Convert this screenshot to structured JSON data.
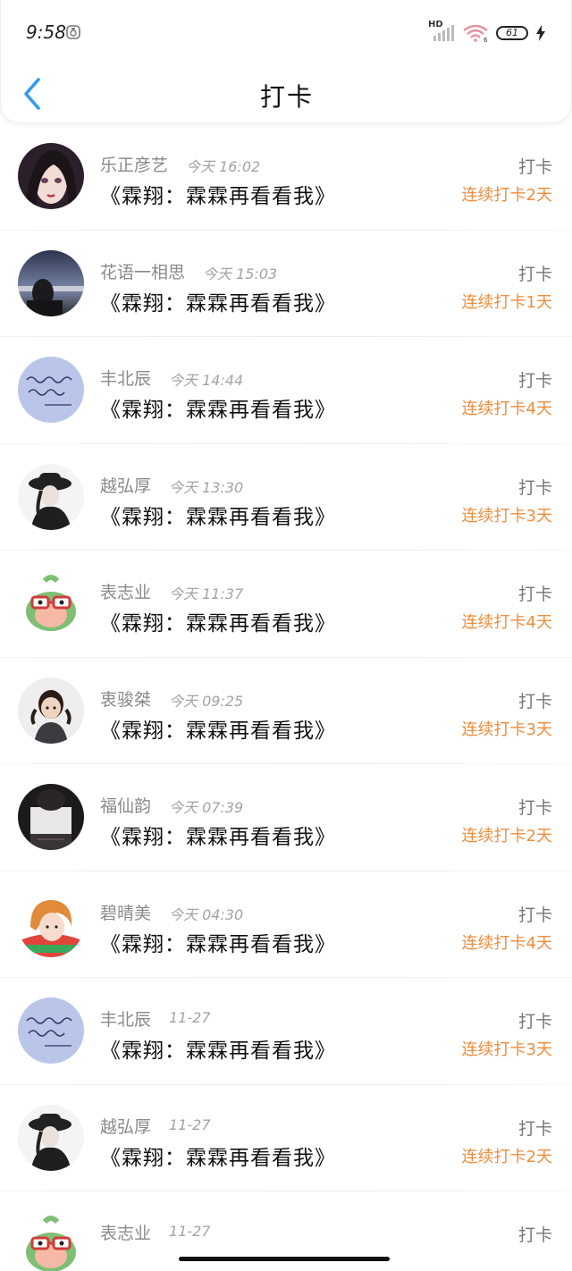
{
  "status_bar": {
    "time": "9:58",
    "hd": "HD",
    "battery": "61",
    "network_sub": "6"
  },
  "header": {
    "title": "打卡"
  },
  "colors": {
    "accent_blue": "#2f9bf0",
    "streak_orange": "#f08c3c"
  },
  "entries": [
    {
      "name": "乐正彦艺",
      "time": "今天 16:02",
      "book": "《霖翔：霖霖再看看我》",
      "action": "打卡",
      "streak": "连续打卡2天",
      "avatar": "girl-portrait-avatar"
    },
    {
      "name": "花语一相思",
      "time": "今天 15:03",
      "book": "《霖翔：霖霖再看看我》",
      "action": "打卡",
      "streak": "连续打卡1天",
      "avatar": "night-sky-girl-avatar"
    },
    {
      "name": "丰北辰",
      "time": "今天 14:44",
      "book": "《霖翔：霖霖再看看我》",
      "action": "打卡",
      "streak": "连续打卡4天",
      "avatar": "handwriting-avatar"
    },
    {
      "name": "越弘厚",
      "time": "今天 13:30",
      "book": "《霖翔：霖霖再看看我》",
      "action": "打卡",
      "streak": "连续打卡3天",
      "avatar": "hat-girl-avatar"
    },
    {
      "name": "表志业",
      "time": "今天 11:37",
      "book": "《霖翔：霖霖再看看我》",
      "action": "打卡",
      "streak": "连续打卡4天",
      "avatar": "cartoon-avatar"
    },
    {
      "name": "衷骏桀",
      "time": "今天 09:25",
      "book": "《霖翔：霖霖再看看我》",
      "action": "打卡",
      "streak": "连续打卡3天",
      "avatar": "child-avatar"
    },
    {
      "name": "福仙韵",
      "time": "今天 07:39",
      "book": "《霖翔：霖霖再看看我》",
      "action": "打卡",
      "streak": "连续打卡2天",
      "avatar": "dark-photo-avatar"
    },
    {
      "name": "碧晴美",
      "time": "今天 04:30",
      "book": "《霖翔：霖霖再看看我》",
      "action": "打卡",
      "streak": "连续打卡4天",
      "avatar": "redhair-girl-avatar"
    },
    {
      "name": "丰北辰",
      "time": "11-27",
      "book": "《霖翔：霖霖再看看我》",
      "action": "打卡",
      "streak": "连续打卡3天",
      "avatar": "handwriting-avatar"
    },
    {
      "name": "越弘厚",
      "time": "11-27",
      "book": "《霖翔：霖霖再看看我》",
      "action": "打卡",
      "streak": "连续打卡2天",
      "avatar": "hat-girl-avatar"
    },
    {
      "name": "表志业",
      "time": "11-27",
      "book": "",
      "action": "打卡",
      "streak": "",
      "avatar": "cartoon-avatar"
    }
  ]
}
